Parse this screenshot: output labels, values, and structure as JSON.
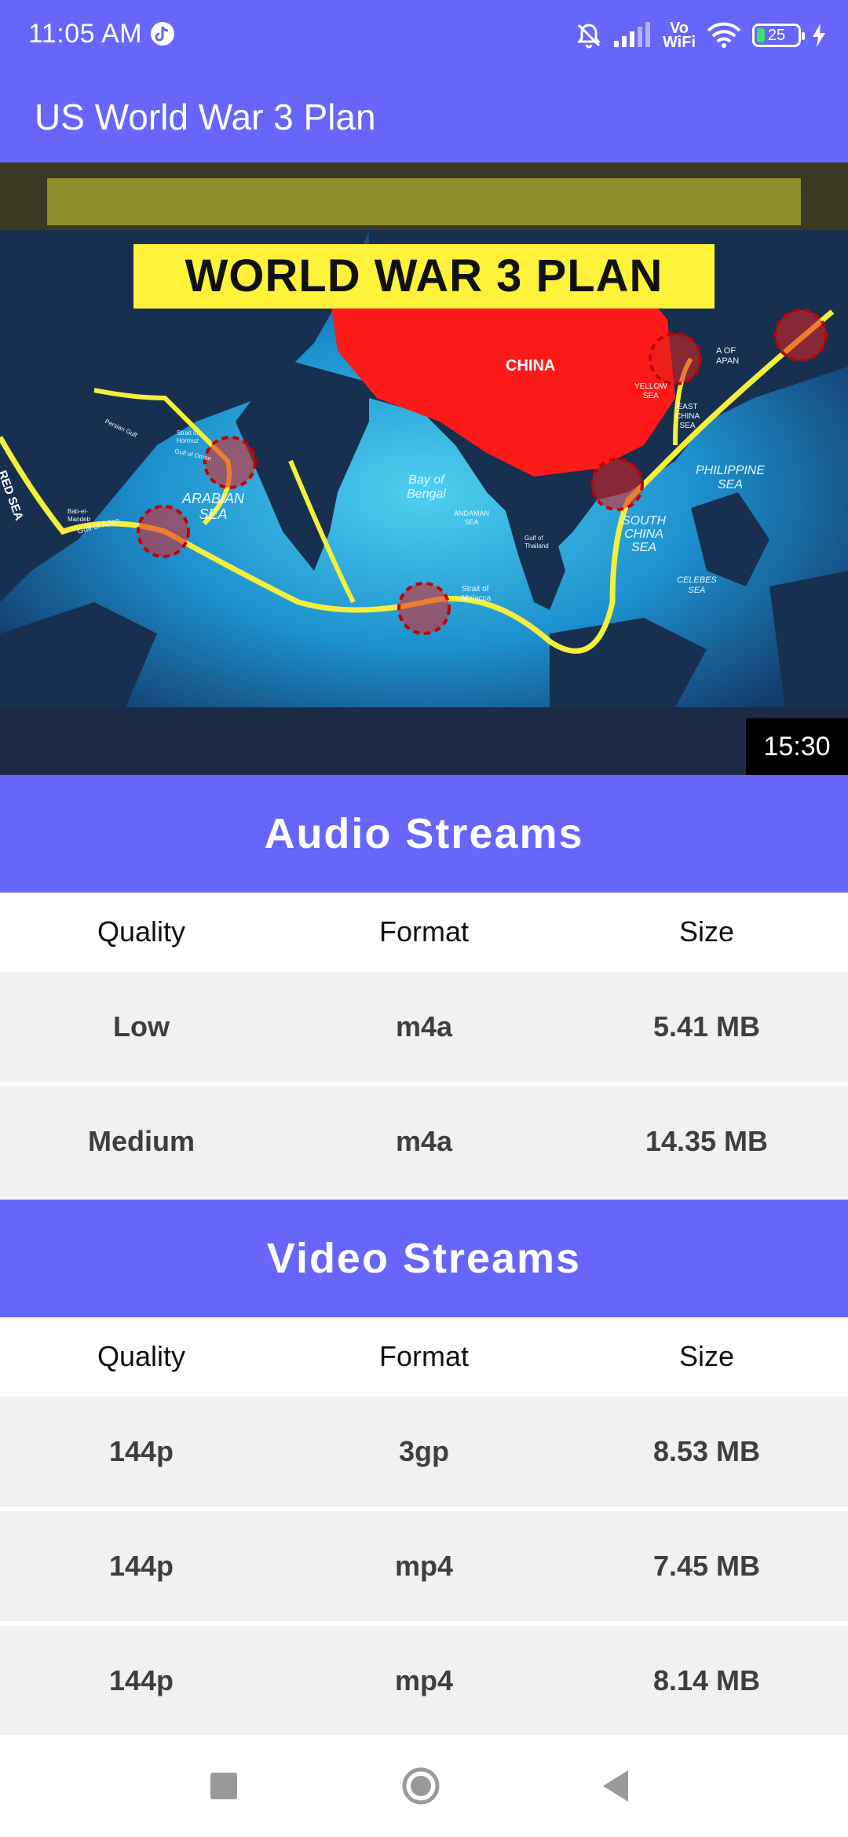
{
  "status_bar": {
    "time": "11:05 AM",
    "vowifi_top": "Vo",
    "vowifi_bottom": "WiFi",
    "battery": "25",
    "icons": [
      "tiktok-icon",
      "mute-bell-icon",
      "signal-icon",
      "vowifi-icon",
      "wifi-icon",
      "battery-icon",
      "charging-bolt-icon"
    ]
  },
  "app_bar": {
    "title": "US World War 3 Plan"
  },
  "thumbnail": {
    "headline": "WORLD WAR 3 PLAN",
    "duration": "15:30",
    "labels": {
      "china": "CHINA",
      "red_sea": "RED SEA",
      "arabian_sea_1": "ARABIAN",
      "arabian_sea_2": "SEA",
      "bay_1": "Bay of",
      "bay_2": "Bengal",
      "andaman_1": "ANDAMAN",
      "andaman_2": "SEA",
      "philippine_1": "PHILIPPINE",
      "philippine_2": "SEA",
      "scs_1": "SOUTH",
      "scs_2": "CHINA",
      "scs_3": "SEA",
      "celebes_1": "CELEBES",
      "celebes_2": "SEA",
      "malacca_1": "Strait of",
      "malacca_2": "Malacca",
      "hormuz_1": "Strait of",
      "hormuz_2": "Hormuz",
      "aden": "Gulf of Aden",
      "bab_1": "Bab-el-",
      "bab_2": "Mandeb",
      "thailand_1": "Gulf of",
      "thailand_2": "Thailand",
      "yellow_1": "YELLOW",
      "yellow_2": "SEA",
      "east_1": "EAST",
      "east_2": "CHINA",
      "east_3": "SEA",
      "japan_1": "A OF",
      "japan_2": "APAN",
      "persian": "Persian Gulf",
      "oman": "Gulf of Oman"
    },
    "colors": {
      "route": "#f4ef3c",
      "china": "#ff1a1a",
      "headline_bg": "#fff23a"
    }
  },
  "audio": {
    "title": "Audio Streams",
    "headers": [
      "Quality",
      "Format",
      "Size"
    ],
    "rows": [
      [
        "Low",
        "m4a",
        "5.41 MB"
      ],
      [
        "Medium",
        "m4a",
        "14.35 MB"
      ]
    ]
  },
  "video": {
    "title": "Video Streams",
    "headers": [
      "Quality",
      "Format",
      "Size"
    ],
    "rows": [
      [
        "144p",
        "3gp",
        "8.53 MB"
      ],
      [
        "144p",
        "mp4",
        "7.45 MB"
      ],
      [
        "144p",
        "mp4",
        "8.14 MB"
      ]
    ]
  },
  "nav_bar": {
    "icons": [
      "recents-square-icon",
      "home-circle-icon",
      "back-triangle-icon"
    ]
  },
  "colors": {
    "accent": "#6666fa",
    "row_bg": "#f1f1f1"
  }
}
